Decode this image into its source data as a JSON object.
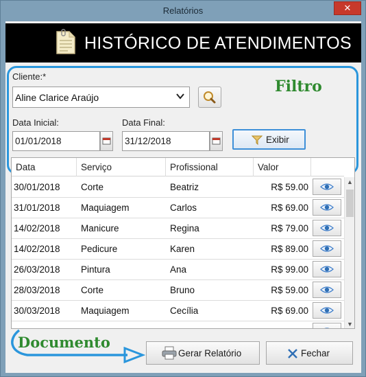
{
  "window": {
    "title": "Relatórios",
    "close_glyph": "✕"
  },
  "header": {
    "title": "HISTÓRICO DE ATENDIMENTOS",
    "icon": "document-icon"
  },
  "annotations": {
    "filtro": "Filtro",
    "documento": "Documento",
    "color": "#2f8a2f",
    "frame_color": "#2a96dc"
  },
  "filter": {
    "cliente_label": "Cliente:*",
    "cliente_value": "Aline Clarice Araújo",
    "data_inicial_label": "Data Inicial:",
    "data_inicial_value": "01/01/2018",
    "data_final_label": "Data Final:",
    "data_final_value": "31/12/2018",
    "exibir_label": "Exibir"
  },
  "table": {
    "columns": [
      "Data",
      "Serviço",
      "Profissional",
      "Valor"
    ],
    "rows": [
      {
        "data": "30/01/2018",
        "servico": "Corte",
        "profissional": "Beatriz",
        "valor": "R$ 59.00"
      },
      {
        "data": "31/01/2018",
        "servico": "Maquiagem",
        "profissional": "Carlos",
        "valor": "R$ 69.00"
      },
      {
        "data": "14/02/2018",
        "servico": "Manicure",
        "profissional": "Regina",
        "valor": "R$ 79.00"
      },
      {
        "data": "14/02/2018",
        "servico": "Pedicure",
        "profissional": "Karen",
        "valor": "R$ 89.00"
      },
      {
        "data": "26/03/2018",
        "servico": "Pintura",
        "profissional": "Ana",
        "valor": "R$ 99.00"
      },
      {
        "data": "28/03/2018",
        "servico": "Corte",
        "profissional": "Bruno",
        "valor": "R$ 59.00"
      },
      {
        "data": "30/03/2018",
        "servico": "Maquiagem",
        "profissional": "Cecília",
        "valor": "R$ 69.00"
      },
      {
        "data": "",
        "servico": "",
        "profissional": "",
        "valor": ""
      }
    ]
  },
  "footer": {
    "gerar_label": "Gerar Relatório",
    "fechar_label": "Fechar"
  }
}
